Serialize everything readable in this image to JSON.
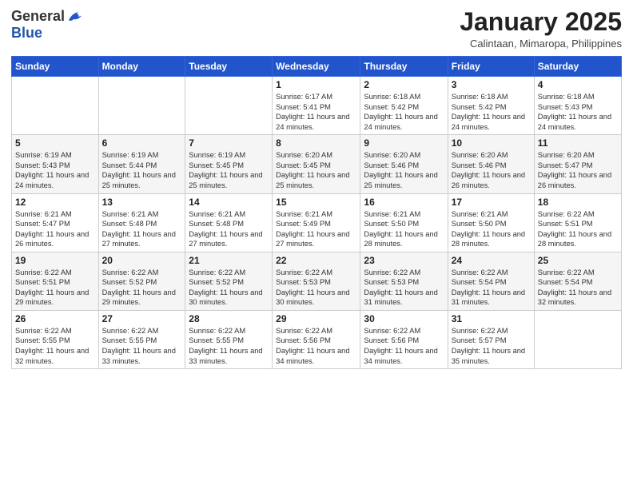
{
  "header": {
    "logo_general": "General",
    "logo_blue": "Blue",
    "month_title": "January 2025",
    "location": "Calintaan, Mimaropa, Philippines"
  },
  "days_of_week": [
    "Sunday",
    "Monday",
    "Tuesday",
    "Wednesday",
    "Thursday",
    "Friday",
    "Saturday"
  ],
  "weeks": [
    [
      {
        "day": "",
        "content": ""
      },
      {
        "day": "",
        "content": ""
      },
      {
        "day": "",
        "content": ""
      },
      {
        "day": "1",
        "content": "Sunrise: 6:17 AM\nSunset: 5:41 PM\nDaylight: 11 hours and 24 minutes."
      },
      {
        "day": "2",
        "content": "Sunrise: 6:18 AM\nSunset: 5:42 PM\nDaylight: 11 hours and 24 minutes."
      },
      {
        "day": "3",
        "content": "Sunrise: 6:18 AM\nSunset: 5:42 PM\nDaylight: 11 hours and 24 minutes."
      },
      {
        "day": "4",
        "content": "Sunrise: 6:18 AM\nSunset: 5:43 PM\nDaylight: 11 hours and 24 minutes."
      }
    ],
    [
      {
        "day": "5",
        "content": "Sunrise: 6:19 AM\nSunset: 5:43 PM\nDaylight: 11 hours and 24 minutes."
      },
      {
        "day": "6",
        "content": "Sunrise: 6:19 AM\nSunset: 5:44 PM\nDaylight: 11 hours and 25 minutes."
      },
      {
        "day": "7",
        "content": "Sunrise: 6:19 AM\nSunset: 5:45 PM\nDaylight: 11 hours and 25 minutes."
      },
      {
        "day": "8",
        "content": "Sunrise: 6:20 AM\nSunset: 5:45 PM\nDaylight: 11 hours and 25 minutes."
      },
      {
        "day": "9",
        "content": "Sunrise: 6:20 AM\nSunset: 5:46 PM\nDaylight: 11 hours and 25 minutes."
      },
      {
        "day": "10",
        "content": "Sunrise: 6:20 AM\nSunset: 5:46 PM\nDaylight: 11 hours and 26 minutes."
      },
      {
        "day": "11",
        "content": "Sunrise: 6:20 AM\nSunset: 5:47 PM\nDaylight: 11 hours and 26 minutes."
      }
    ],
    [
      {
        "day": "12",
        "content": "Sunrise: 6:21 AM\nSunset: 5:47 PM\nDaylight: 11 hours and 26 minutes."
      },
      {
        "day": "13",
        "content": "Sunrise: 6:21 AM\nSunset: 5:48 PM\nDaylight: 11 hours and 27 minutes."
      },
      {
        "day": "14",
        "content": "Sunrise: 6:21 AM\nSunset: 5:48 PM\nDaylight: 11 hours and 27 minutes."
      },
      {
        "day": "15",
        "content": "Sunrise: 6:21 AM\nSunset: 5:49 PM\nDaylight: 11 hours and 27 minutes."
      },
      {
        "day": "16",
        "content": "Sunrise: 6:21 AM\nSunset: 5:50 PM\nDaylight: 11 hours and 28 minutes."
      },
      {
        "day": "17",
        "content": "Sunrise: 6:21 AM\nSunset: 5:50 PM\nDaylight: 11 hours and 28 minutes."
      },
      {
        "day": "18",
        "content": "Sunrise: 6:22 AM\nSunset: 5:51 PM\nDaylight: 11 hours and 28 minutes."
      }
    ],
    [
      {
        "day": "19",
        "content": "Sunrise: 6:22 AM\nSunset: 5:51 PM\nDaylight: 11 hours and 29 minutes."
      },
      {
        "day": "20",
        "content": "Sunrise: 6:22 AM\nSunset: 5:52 PM\nDaylight: 11 hours and 29 minutes."
      },
      {
        "day": "21",
        "content": "Sunrise: 6:22 AM\nSunset: 5:52 PM\nDaylight: 11 hours and 30 minutes."
      },
      {
        "day": "22",
        "content": "Sunrise: 6:22 AM\nSunset: 5:53 PM\nDaylight: 11 hours and 30 minutes."
      },
      {
        "day": "23",
        "content": "Sunrise: 6:22 AM\nSunset: 5:53 PM\nDaylight: 11 hours and 31 minutes."
      },
      {
        "day": "24",
        "content": "Sunrise: 6:22 AM\nSunset: 5:54 PM\nDaylight: 11 hours and 31 minutes."
      },
      {
        "day": "25",
        "content": "Sunrise: 6:22 AM\nSunset: 5:54 PM\nDaylight: 11 hours and 32 minutes."
      }
    ],
    [
      {
        "day": "26",
        "content": "Sunrise: 6:22 AM\nSunset: 5:55 PM\nDaylight: 11 hours and 32 minutes."
      },
      {
        "day": "27",
        "content": "Sunrise: 6:22 AM\nSunset: 5:55 PM\nDaylight: 11 hours and 33 minutes."
      },
      {
        "day": "28",
        "content": "Sunrise: 6:22 AM\nSunset: 5:55 PM\nDaylight: 11 hours and 33 minutes."
      },
      {
        "day": "29",
        "content": "Sunrise: 6:22 AM\nSunset: 5:56 PM\nDaylight: 11 hours and 34 minutes."
      },
      {
        "day": "30",
        "content": "Sunrise: 6:22 AM\nSunset: 5:56 PM\nDaylight: 11 hours and 34 minutes."
      },
      {
        "day": "31",
        "content": "Sunrise: 6:22 AM\nSunset: 5:57 PM\nDaylight: 11 hours and 35 minutes."
      },
      {
        "day": "",
        "content": ""
      }
    ]
  ]
}
